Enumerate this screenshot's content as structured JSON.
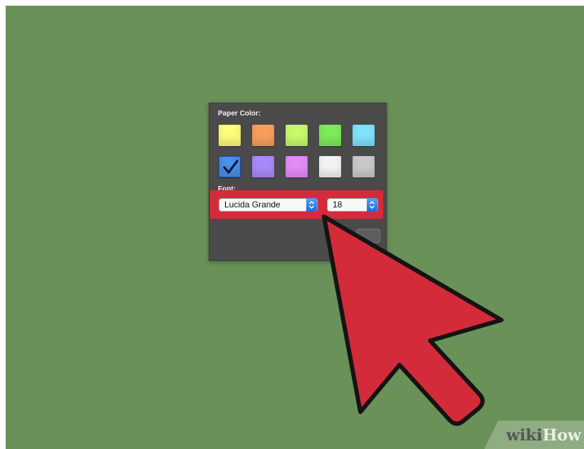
{
  "panel": {
    "paper_color_label": "Paper Color:",
    "font_label": "Font:",
    "swatches": [
      {
        "name": "yellow",
        "color": "#fdfc7b",
        "selected": false
      },
      {
        "name": "orange",
        "color": "#fa9e5c",
        "selected": false
      },
      {
        "name": "lime",
        "color": "#c9f96a",
        "selected": false
      },
      {
        "name": "green",
        "color": "#7deb5a",
        "selected": false
      },
      {
        "name": "cyan",
        "color": "#7ee3fb",
        "selected": false
      },
      {
        "name": "blue",
        "color": "#4a8fe8",
        "selected": true
      },
      {
        "name": "purple",
        "color": "#a98af8",
        "selected": false
      },
      {
        "name": "pink",
        "color": "#e38cf7",
        "selected": false
      },
      {
        "name": "white",
        "color": "#f3f3f3",
        "selected": false
      },
      {
        "name": "gray",
        "color": "#c9c9c9",
        "selected": false
      }
    ],
    "font_name": "Lucida Grande",
    "font_size": "18"
  },
  "highlight_color": "#d42b3a",
  "watermark": {
    "part1": "wiki",
    "part2": "How"
  }
}
